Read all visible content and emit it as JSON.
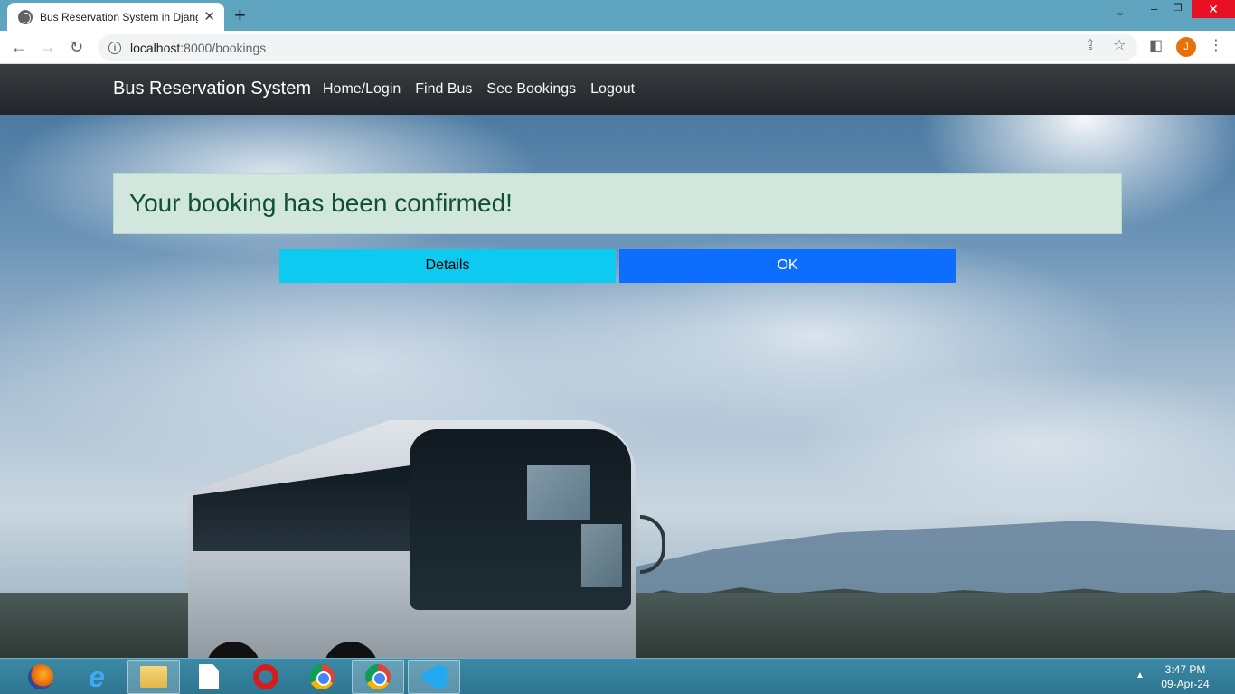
{
  "browser": {
    "tab_title": "Bus Reservation System in Django",
    "tab_close": "✕",
    "new_tab": "+",
    "url_host": "localhost",
    "url_path": ":8000/bookings",
    "window_close": "✕",
    "avatar_initial": "J"
  },
  "navbar": {
    "brand": "Bus Reservation System",
    "links": [
      "Home/Login",
      "Find Bus",
      "See Bookings",
      "Logout"
    ]
  },
  "main": {
    "alert_message": "Your booking has been confirmed!",
    "details_button": "Details",
    "ok_button": "OK"
  },
  "taskbar": {
    "time": "3:47 PM",
    "date": "09-Apr-24",
    "apps": [
      "firefox",
      "internet-explorer",
      "file-explorer",
      "notepad-file",
      "opera",
      "chrome",
      "chrome-active",
      "vscode"
    ]
  },
  "colors": {
    "alert_bg": "#d1e7dd",
    "alert_text": "#0f5132",
    "details_btn": "#0dcaf0",
    "ok_btn": "#0d6efd",
    "navbar": "#212529"
  }
}
